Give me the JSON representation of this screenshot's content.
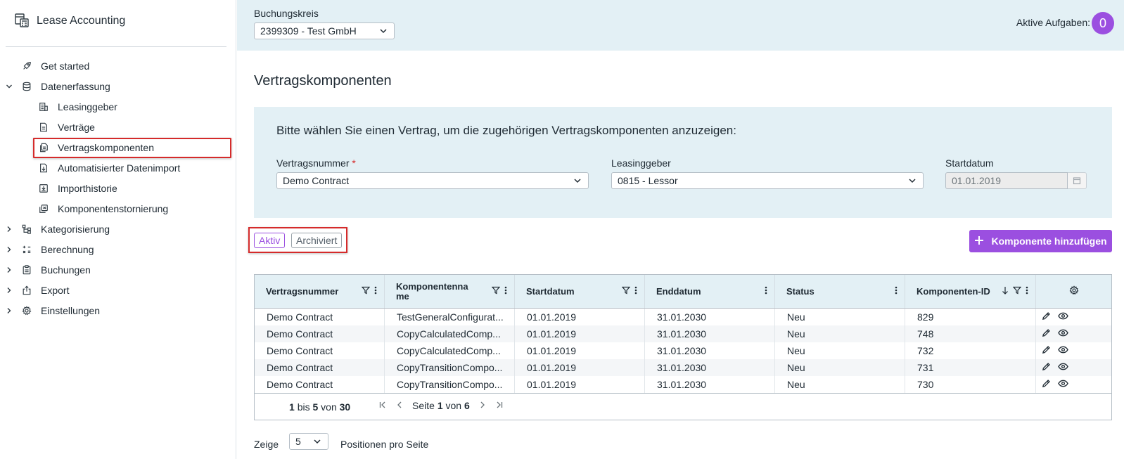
{
  "app": {
    "title": "Lease Accounting"
  },
  "sidebar": {
    "items": [
      {
        "label": "Get started",
        "icon": "rocket-icon"
      },
      {
        "label": "Datenerfassung",
        "icon": "database-icon",
        "expanded": true
      },
      {
        "label": "Leasinggeber",
        "icon": "building-icon"
      },
      {
        "label": "Verträge",
        "icon": "document-icon"
      },
      {
        "label": "Vertragskomponenten",
        "icon": "documents-icon",
        "selected": true
      },
      {
        "label": "Automatisierter Datenimport",
        "icon": "file-import-icon"
      },
      {
        "label": "Importhistorie",
        "icon": "download-history-icon"
      },
      {
        "label": "Komponentenstornierung",
        "icon": "cancel-swap-icon"
      },
      {
        "label": "Kategorisierung",
        "icon": "hierarchy-icon"
      },
      {
        "label": "Berechnung",
        "icon": "calculator-icon"
      },
      {
        "label": "Buchungen",
        "icon": "clipboard-icon"
      },
      {
        "label": "Export",
        "icon": "export-icon"
      },
      {
        "label": "Einstellungen",
        "icon": "gear-icon"
      }
    ]
  },
  "header": {
    "company_label": "Buchungskreis",
    "company_value": "2399309 - Test GmbH",
    "tasks_label": "Aktive Aufgaben:",
    "tasks_count": "0"
  },
  "main": {
    "title": "Vertragskomponenten",
    "filter": {
      "heading": "Bitte wählen Sie einen Vertrag, um die zugehörigen Vertragskomponenten anzuzeigen:",
      "contract_label": "Vertragsnummer",
      "required_mark": "*",
      "contract_value": "Demo Contract",
      "lessor_label": "Leasinggeber",
      "lessor_value": "0815 - Lessor",
      "start_label": "Startdatum",
      "start_value": "01.01.2019"
    },
    "toggle": {
      "active": "Aktiv",
      "archived": "Archiviert"
    },
    "add_button": "Komponente hinzufügen"
  },
  "table": {
    "columns": [
      "Vertragsnummer",
      "Komponentenna me",
      "Startdatum",
      "Enddatum",
      "Status",
      "Komponenten-ID"
    ],
    "rows": [
      [
        "Demo Contract",
        "TestGeneralConfigurat...",
        "01.01.2019",
        "31.01.2030",
        "Neu",
        "829"
      ],
      [
        "Demo Contract",
        "CopyCalculatedComp...",
        "01.01.2019",
        "31.01.2030",
        "Neu",
        "748"
      ],
      [
        "Demo Contract",
        "CopyCalculatedComp...",
        "01.01.2019",
        "31.01.2030",
        "Neu",
        "732"
      ],
      [
        "Demo Contract",
        "CopyTransitionCompo...",
        "01.01.2019",
        "31.01.2030",
        "Neu",
        "731"
      ],
      [
        "Demo Contract",
        "CopyTransitionCompo...",
        "01.01.2019",
        "31.01.2030",
        "Neu",
        "730"
      ]
    ],
    "pager": {
      "from": "1",
      "bis": "bis",
      "to": "5",
      "von": "von",
      "total": "30",
      "seite": "Seite",
      "page": "1",
      "von2": "von",
      "pages": "6"
    }
  },
  "footer": {
    "show_label": "Zeige",
    "page_size": "5",
    "per_page_label": "Positionen pro Seite"
  },
  "colors": {
    "accent": "#9b4fe0",
    "panel": "#e3f0f5",
    "highlight": "#d52b2b"
  }
}
